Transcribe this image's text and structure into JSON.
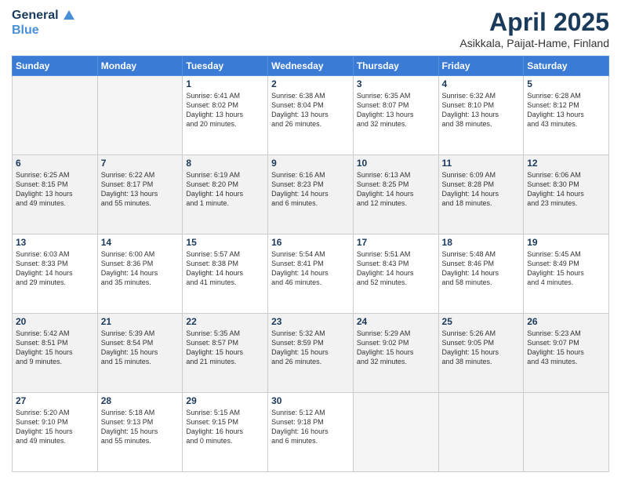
{
  "header": {
    "logo_line1": "General",
    "logo_line2": "Blue",
    "title": "April 2025",
    "subtitle": "Asikkala, Paijat-Hame, Finland"
  },
  "days_of_week": [
    "Sunday",
    "Monday",
    "Tuesday",
    "Wednesday",
    "Thursday",
    "Friday",
    "Saturday"
  ],
  "weeks": [
    [
      {
        "day": "",
        "info": ""
      },
      {
        "day": "",
        "info": ""
      },
      {
        "day": "1",
        "info": "Sunrise: 6:41 AM\nSunset: 8:02 PM\nDaylight: 13 hours\nand 20 minutes."
      },
      {
        "day": "2",
        "info": "Sunrise: 6:38 AM\nSunset: 8:04 PM\nDaylight: 13 hours\nand 26 minutes."
      },
      {
        "day": "3",
        "info": "Sunrise: 6:35 AM\nSunset: 8:07 PM\nDaylight: 13 hours\nand 32 minutes."
      },
      {
        "day": "4",
        "info": "Sunrise: 6:32 AM\nSunset: 8:10 PM\nDaylight: 13 hours\nand 38 minutes."
      },
      {
        "day": "5",
        "info": "Sunrise: 6:28 AM\nSunset: 8:12 PM\nDaylight: 13 hours\nand 43 minutes."
      }
    ],
    [
      {
        "day": "6",
        "info": "Sunrise: 6:25 AM\nSunset: 8:15 PM\nDaylight: 13 hours\nand 49 minutes."
      },
      {
        "day": "7",
        "info": "Sunrise: 6:22 AM\nSunset: 8:17 PM\nDaylight: 13 hours\nand 55 minutes."
      },
      {
        "day": "8",
        "info": "Sunrise: 6:19 AM\nSunset: 8:20 PM\nDaylight: 14 hours\nand 1 minute."
      },
      {
        "day": "9",
        "info": "Sunrise: 6:16 AM\nSunset: 8:23 PM\nDaylight: 14 hours\nand 6 minutes."
      },
      {
        "day": "10",
        "info": "Sunrise: 6:13 AM\nSunset: 8:25 PM\nDaylight: 14 hours\nand 12 minutes."
      },
      {
        "day": "11",
        "info": "Sunrise: 6:09 AM\nSunset: 8:28 PM\nDaylight: 14 hours\nand 18 minutes."
      },
      {
        "day": "12",
        "info": "Sunrise: 6:06 AM\nSunset: 8:30 PM\nDaylight: 14 hours\nand 23 minutes."
      }
    ],
    [
      {
        "day": "13",
        "info": "Sunrise: 6:03 AM\nSunset: 8:33 PM\nDaylight: 14 hours\nand 29 minutes."
      },
      {
        "day": "14",
        "info": "Sunrise: 6:00 AM\nSunset: 8:36 PM\nDaylight: 14 hours\nand 35 minutes."
      },
      {
        "day": "15",
        "info": "Sunrise: 5:57 AM\nSunset: 8:38 PM\nDaylight: 14 hours\nand 41 minutes."
      },
      {
        "day": "16",
        "info": "Sunrise: 5:54 AM\nSunset: 8:41 PM\nDaylight: 14 hours\nand 46 minutes."
      },
      {
        "day": "17",
        "info": "Sunrise: 5:51 AM\nSunset: 8:43 PM\nDaylight: 14 hours\nand 52 minutes."
      },
      {
        "day": "18",
        "info": "Sunrise: 5:48 AM\nSunset: 8:46 PM\nDaylight: 14 hours\nand 58 minutes."
      },
      {
        "day": "19",
        "info": "Sunrise: 5:45 AM\nSunset: 8:49 PM\nDaylight: 15 hours\nand 4 minutes."
      }
    ],
    [
      {
        "day": "20",
        "info": "Sunrise: 5:42 AM\nSunset: 8:51 PM\nDaylight: 15 hours\nand 9 minutes."
      },
      {
        "day": "21",
        "info": "Sunrise: 5:39 AM\nSunset: 8:54 PM\nDaylight: 15 hours\nand 15 minutes."
      },
      {
        "day": "22",
        "info": "Sunrise: 5:35 AM\nSunset: 8:57 PM\nDaylight: 15 hours\nand 21 minutes."
      },
      {
        "day": "23",
        "info": "Sunrise: 5:32 AM\nSunset: 8:59 PM\nDaylight: 15 hours\nand 26 minutes."
      },
      {
        "day": "24",
        "info": "Sunrise: 5:29 AM\nSunset: 9:02 PM\nDaylight: 15 hours\nand 32 minutes."
      },
      {
        "day": "25",
        "info": "Sunrise: 5:26 AM\nSunset: 9:05 PM\nDaylight: 15 hours\nand 38 minutes."
      },
      {
        "day": "26",
        "info": "Sunrise: 5:23 AM\nSunset: 9:07 PM\nDaylight: 15 hours\nand 43 minutes."
      }
    ],
    [
      {
        "day": "27",
        "info": "Sunrise: 5:20 AM\nSunset: 9:10 PM\nDaylight: 15 hours\nand 49 minutes."
      },
      {
        "day": "28",
        "info": "Sunrise: 5:18 AM\nSunset: 9:13 PM\nDaylight: 15 hours\nand 55 minutes."
      },
      {
        "day": "29",
        "info": "Sunrise: 5:15 AM\nSunset: 9:15 PM\nDaylight: 16 hours\nand 0 minutes."
      },
      {
        "day": "30",
        "info": "Sunrise: 5:12 AM\nSunset: 9:18 PM\nDaylight: 16 hours\nand 6 minutes."
      },
      {
        "day": "",
        "info": ""
      },
      {
        "day": "",
        "info": ""
      },
      {
        "day": "",
        "info": ""
      }
    ]
  ]
}
